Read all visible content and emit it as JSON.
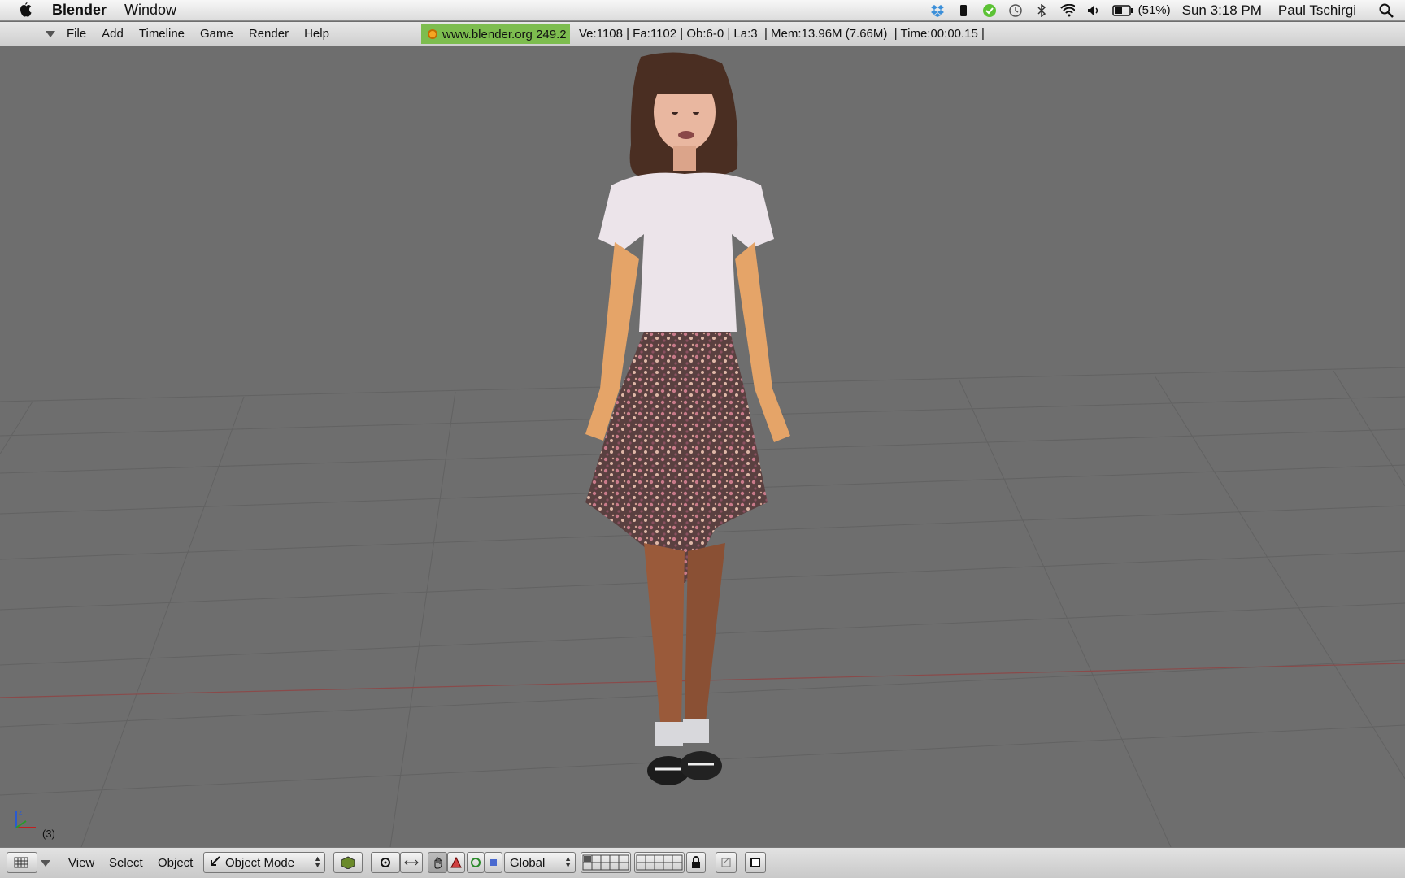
{
  "mac_menubar": {
    "app_name": "Blender",
    "menus": [
      "Window"
    ],
    "battery_text": "(51%)",
    "clock": "Sun 3:18 PM",
    "user": "Paul Tschirgi"
  },
  "blender_header": {
    "menus": [
      "File",
      "Add",
      "Timeline",
      "Game",
      "Render",
      "Help"
    ],
    "version_label": "www.blender.org 249.2",
    "stats": "Ve:1108 | Fa:1102 | Ob:6-0 | La:3  | Mem:13.96M (7.66M)  | Time:00:00.15 |"
  },
  "viewport": {
    "frame_number": "(3)"
  },
  "bottom_header": {
    "menus": [
      "View",
      "Select",
      "Object"
    ],
    "mode": "Object Mode",
    "orientation": "Global"
  },
  "colors": {
    "viewport_bg": "#6e6e6e",
    "grid": "#5f5f5f",
    "x_axis": "#8a4a4a",
    "info_green": "#7dbd4f"
  }
}
